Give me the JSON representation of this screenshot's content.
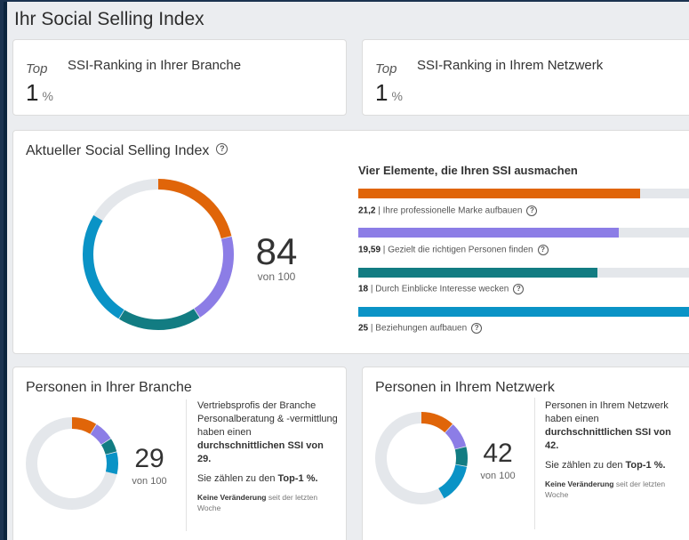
{
  "page": {
    "title": "Ihr Social Selling Index"
  },
  "ranking": [
    {
      "top_label": "Top",
      "title": "SSI-Ranking in Ihrer Branche",
      "value": "1",
      "unit": "%"
    },
    {
      "top_label": "Top",
      "title": "SSI-Ranking in Ihrem Netzwerk",
      "value": "1",
      "unit": "%"
    }
  ],
  "ssi": {
    "title": "Aktueller Social Selling Index",
    "score": "84",
    "score_sub": "von 100",
    "elements_title": "Vier Elemente, die Ihren SSI ausmachen",
    "elements": [
      {
        "value": "21,2",
        "value_num": 21.2,
        "max": 25,
        "label": "Ihre professionelle Marke aufbauen",
        "color": "#e06509"
      },
      {
        "value": "19,59",
        "value_num": 19.59,
        "max": 25,
        "label": "Gezielt die richtigen Personen finden",
        "color": "#8c7de6"
      },
      {
        "value": "18",
        "value_num": 18,
        "max": 25,
        "label": "Durch Einblicke Interesse wecken",
        "color": "#127c82"
      },
      {
        "value": "25",
        "value_num": 25,
        "max": 25,
        "label": "Beziehungen aufbauen",
        "color": "#0a93c6"
      }
    ]
  },
  "branche": {
    "title": "Personen in Ihrer Branche",
    "score": "29",
    "score_sub": "von 100",
    "desc_1": "Vertriebsprofis der Branche Personalberatung & -vermittlung haben einen",
    "desc_bold": "durchschnittlichen SSI von 29.",
    "desc_2a": "Sie zählen zu den ",
    "desc_2b": "Top-1 %.",
    "note_bold": "Keine Veränderung",
    "note_rest": " seit der letzten Woche",
    "segments": [
      9,
      7,
      5,
      8
    ]
  },
  "netzwerk": {
    "title": "Personen in Ihrem Netzwerk",
    "score": "42",
    "score_sub": "von 100",
    "desc_1": "Personen in Ihrem Netzwerk haben einen",
    "desc_bold": "durchschnittlichen SSI von 42.",
    "desc_2a": "Sie zählen zu den ",
    "desc_2b": "Top-1 %.",
    "note_bold": "Keine Veränderung",
    "note_rest": " seit der letzten Woche",
    "segments": [
      12,
      9,
      7,
      14
    ]
  },
  "colors": {
    "orange": "#e06509",
    "purple": "#8c7de6",
    "teal": "#127c82",
    "blue": "#0a93c6",
    "track": "#e4e7eb"
  },
  "icons": {
    "help": "help-circle-icon"
  }
}
